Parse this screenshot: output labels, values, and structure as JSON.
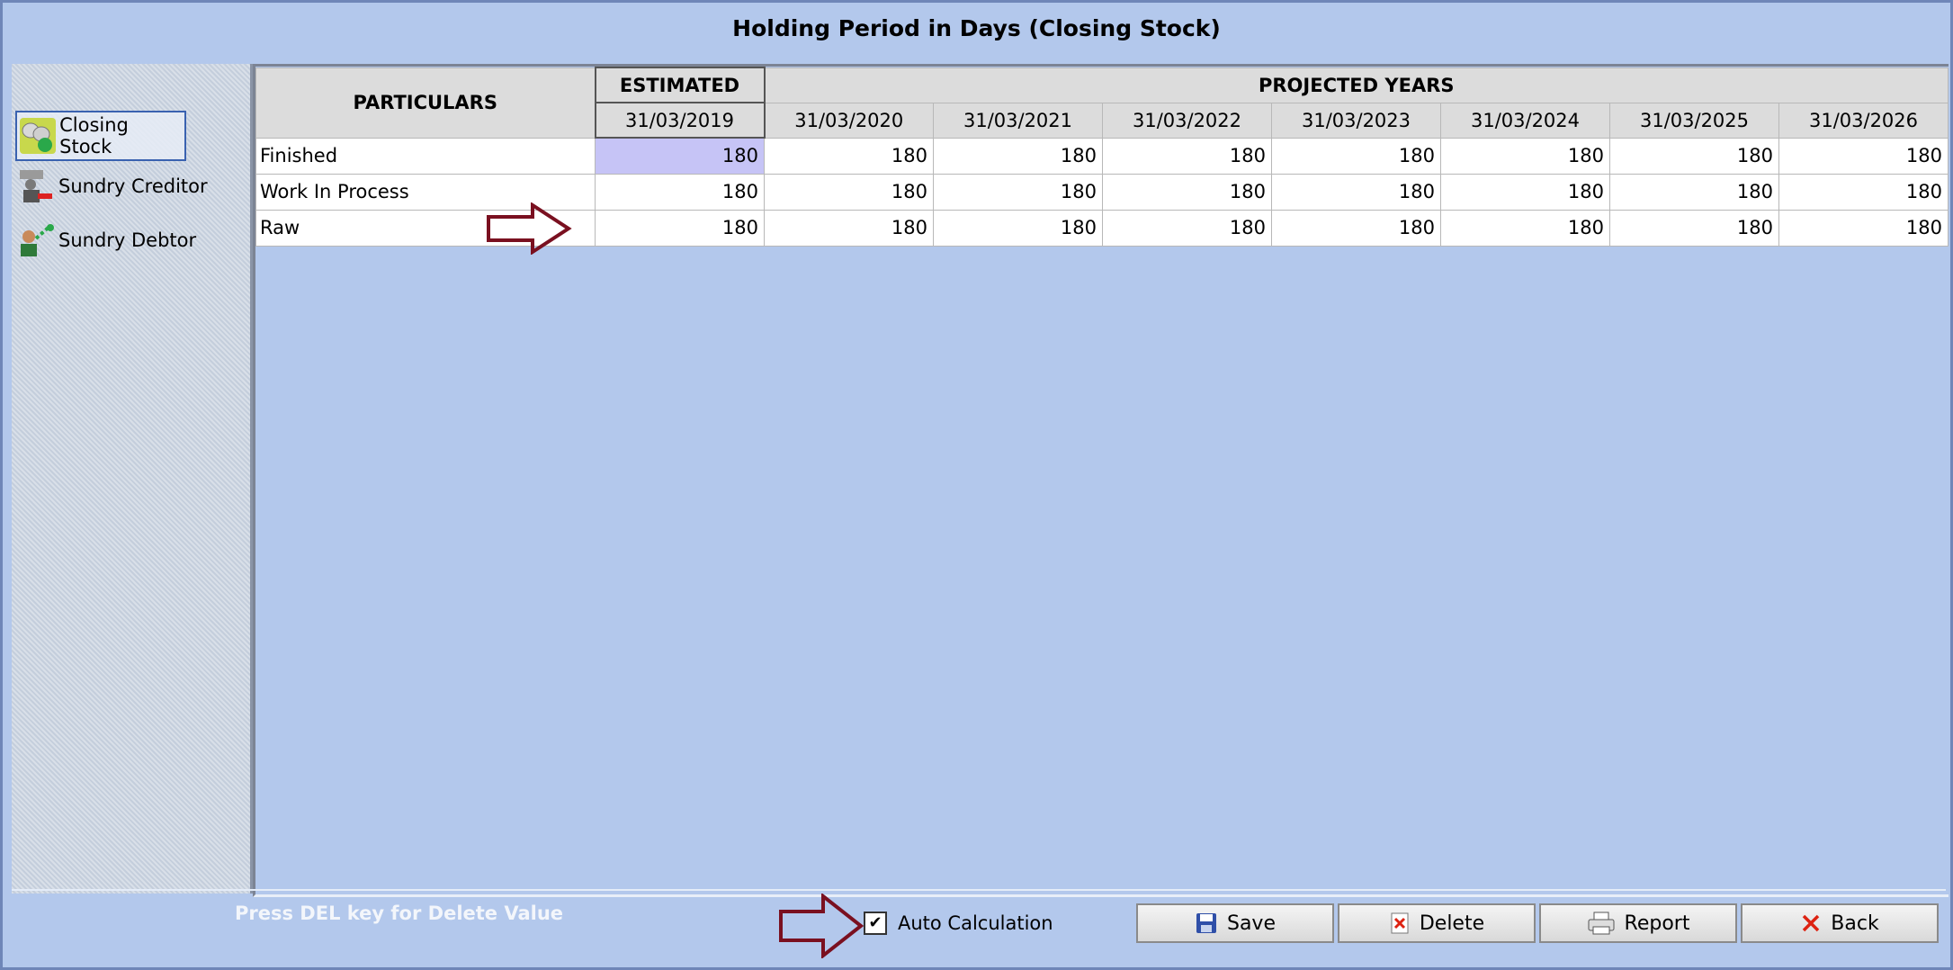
{
  "title": "Holding Period in Days (Closing Stock)",
  "sidebar": {
    "items": [
      {
        "label": "Closing Stock",
        "icon": "closing-stock-icon",
        "selected": true
      },
      {
        "label": "Sundry Creditor",
        "icon": "sundry-creditor-icon",
        "selected": false
      },
      {
        "label": "Sundry Debtor",
        "icon": "sundry-debtor-icon",
        "selected": false
      }
    ]
  },
  "grid": {
    "particulars_header": "PARTICULARS",
    "estimated_header": "ESTIMATED",
    "projected_header": "PROJECTED YEARS",
    "dates": [
      "31/03/2019",
      "31/03/2020",
      "31/03/2021",
      "31/03/2022",
      "31/03/2023",
      "31/03/2024",
      "31/03/2025",
      "31/03/2026"
    ],
    "rows": [
      {
        "name": "Finished",
        "values": [
          "180",
          "180",
          "180",
          "180",
          "180",
          "180",
          "180",
          "180"
        ]
      },
      {
        "name": "Work In Process",
        "values": [
          "180",
          "180",
          "180",
          "180",
          "180",
          "180",
          "180",
          "180"
        ]
      },
      {
        "name": "Raw",
        "values": [
          "180",
          "180",
          "180",
          "180",
          "180",
          "180",
          "180",
          "180"
        ]
      }
    ]
  },
  "status_text": "Press DEL key for Delete Value",
  "auto_calculation": {
    "label": "Auto Calculation",
    "checked": true
  },
  "buttons": {
    "save": "Save",
    "delete": "Delete",
    "report": "Report",
    "back": "Back"
  },
  "colors": {
    "accent_arrow": "#7a1020",
    "selected_cell": "#c6c4f6",
    "background": "#b3c8ec"
  }
}
